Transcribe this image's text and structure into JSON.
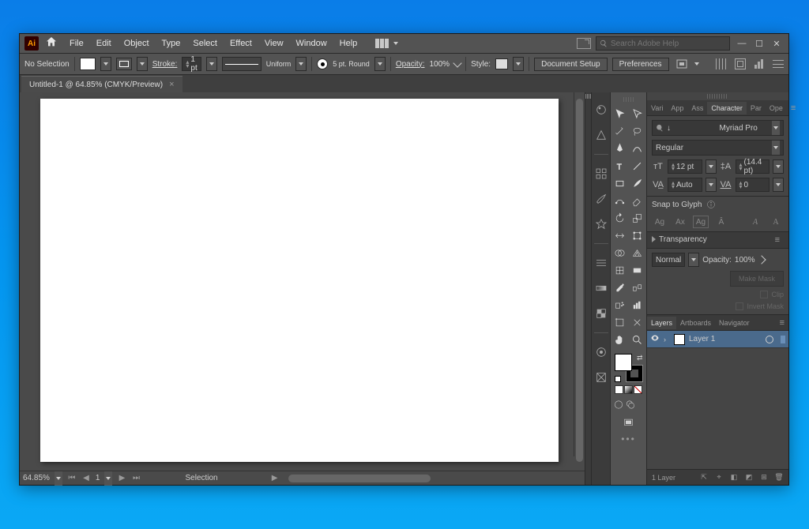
{
  "menu": {
    "file": "File",
    "edit": "Edit",
    "object": "Object",
    "type": "Type",
    "select": "Select",
    "effect": "Effect",
    "view": "View",
    "window": "Window",
    "help": "Help"
  },
  "search": {
    "placeholder": "Search Adobe Help"
  },
  "control": {
    "noSelection": "No Selection",
    "strokeLabel": "Stroke:",
    "strokeWeight": "1 pt",
    "uniform": "Uniform",
    "brushSize": "5 pt. Round",
    "opacityLabel": "Opacity:",
    "opacityValue": "100%",
    "styleLabel": "Style:",
    "docSetup": "Document Setup",
    "preferences": "Preferences"
  },
  "tab": {
    "title": "Untitled-1 @ 64.85% (CMYK/Preview)"
  },
  "status": {
    "zoom": "64.85%",
    "page": "1",
    "tool": "Selection"
  },
  "character": {
    "tabs": {
      "vari": "Vari",
      "app": "App",
      "ass": "Ass",
      "character": "Character",
      "par": "Par",
      "ope": "Ope"
    },
    "font": "Myriad Pro",
    "style": "Regular",
    "size": "12 pt",
    "leading": "(14.4 pt)",
    "kerning": "Auto",
    "tracking": "0",
    "snapToGlyph": "Snap to Glyph"
  },
  "transparency": {
    "title": "Transparency",
    "blend": "Normal",
    "opacityLabel": "Opacity:",
    "opacityValue": "100%",
    "makeMask": "Make Mask",
    "clip": "Clip",
    "invertMask": "Invert Mask"
  },
  "layers": {
    "tabs": {
      "layers": "Layers",
      "artboards": "Artboards",
      "navigator": "Navigator"
    },
    "layer1": "Layer 1",
    "count": "1 Layer"
  }
}
